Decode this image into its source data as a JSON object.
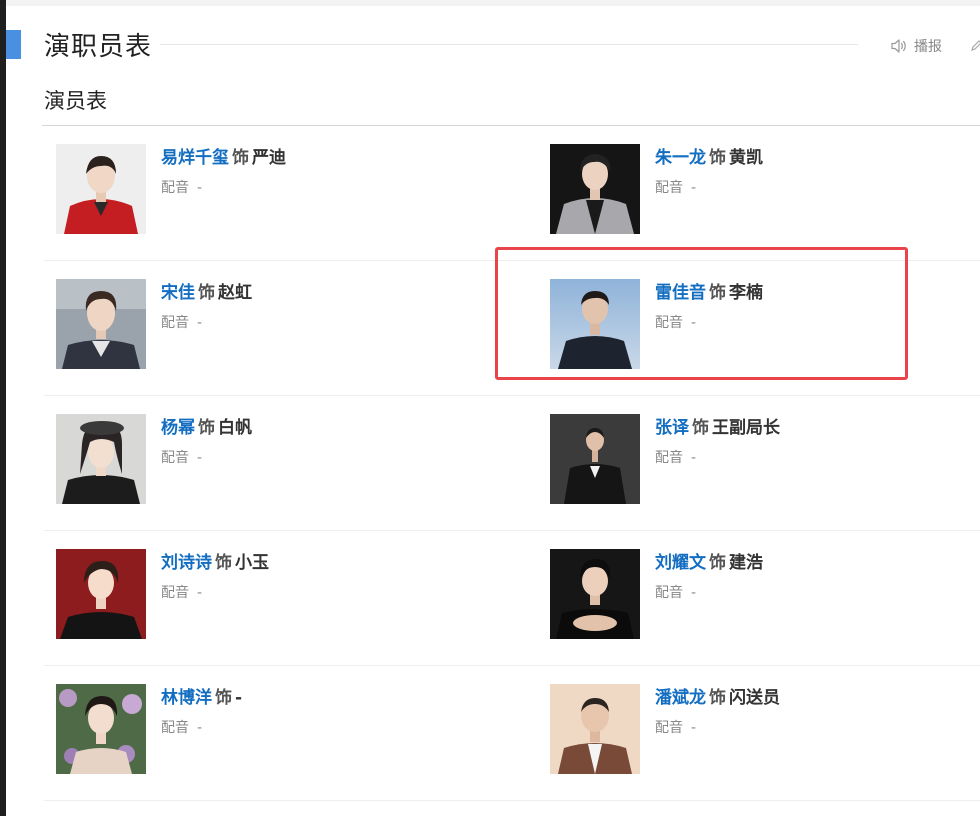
{
  "header": {
    "title": "演职员表",
    "broadcast_label": "播报",
    "broadcast_icon": "speaker-icon",
    "accent_color": "#4a90e2"
  },
  "section": {
    "title": "演员表"
  },
  "cast": [
    {
      "actor": "易烊千玺",
      "sep": "饰",
      "role": "严迪",
      "dub_label": "配音",
      "dub_value": "-"
    },
    {
      "actor": "朱一龙",
      "sep": "饰",
      "role": "黄凯",
      "dub_label": "配音",
      "dub_value": "-"
    },
    {
      "actor": "宋佳",
      "sep": "饰",
      "role": "赵虹",
      "dub_label": "配音",
      "dub_value": "-"
    },
    {
      "actor": "雷佳音",
      "sep": "饰",
      "role": "李楠",
      "dub_label": "配音",
      "dub_value": "-"
    },
    {
      "actor": "杨幂",
      "sep": "饰",
      "role": "白帆",
      "dub_label": "配音",
      "dub_value": "-"
    },
    {
      "actor": "张译",
      "sep": "饰",
      "role": "王副局长",
      "dub_label": "配音",
      "dub_value": "-"
    },
    {
      "actor": "刘诗诗",
      "sep": "饰",
      "role": "小玉",
      "dub_label": "配音",
      "dub_value": "-"
    },
    {
      "actor": "刘耀文",
      "sep": "饰",
      "role": "建浩",
      "dub_label": "配音",
      "dub_value": "-"
    },
    {
      "actor": "林博洋",
      "sep": "饰",
      "role": "-",
      "dub_label": "配音",
      "dub_value": "-"
    },
    {
      "actor": "潘斌龙",
      "sep": "饰",
      "role": "闪送员",
      "dub_label": "配音",
      "dub_value": "-"
    }
  ],
  "colors": {
    "actor_link": "#136ec2",
    "highlight_border": "#e8444a"
  }
}
